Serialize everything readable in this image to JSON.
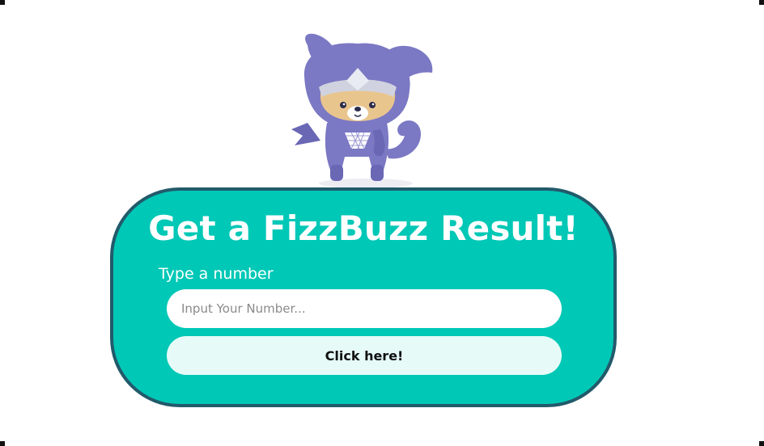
{
  "card": {
    "title": "Get a FizzBuzz Result!",
    "input_label": "Type a number",
    "input_placeholder": "Input Your Number...",
    "input_value": "",
    "button_label": "Click here!"
  },
  "colors": {
    "card_background": "#00c8b6",
    "card_border": "#225a6b",
    "button_background": "#e6fbf8",
    "mascot_body": "#7b78c4"
  },
  "icons": {
    "mascot": "ninja-dog-mascot-icon"
  }
}
